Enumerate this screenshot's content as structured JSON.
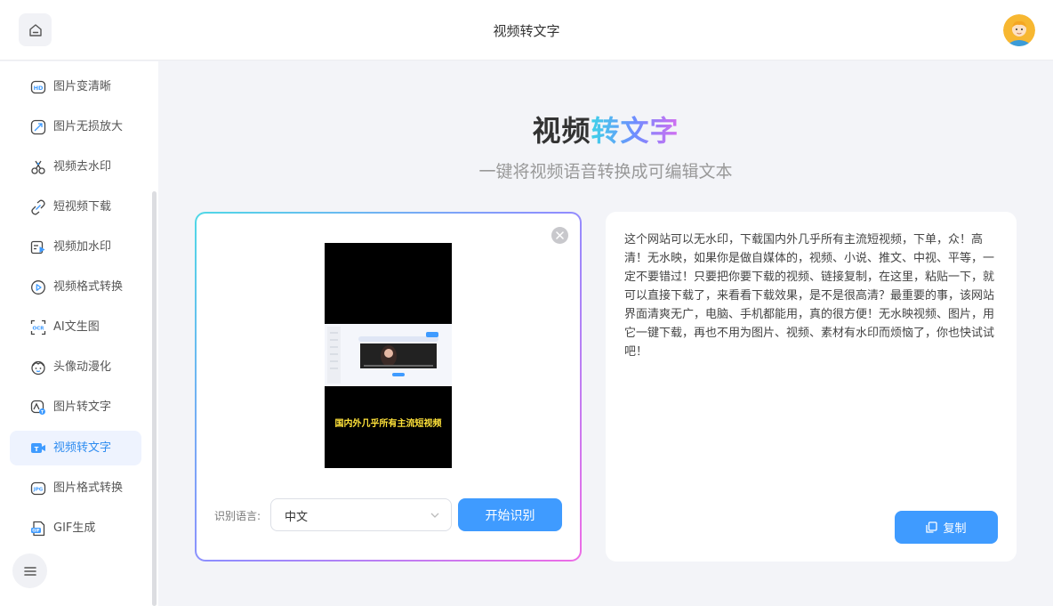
{
  "header": {
    "title": "视频转文字"
  },
  "sidebar": {
    "items": [
      {
        "label": "图片变清晰",
        "icon": "hd-icon"
      },
      {
        "label": "图片无损放大",
        "icon": "enlarge-icon"
      },
      {
        "label": "视频去水印",
        "icon": "scissors-icon"
      },
      {
        "label": "短视频下载",
        "icon": "link-icon"
      },
      {
        "label": "视频加水印",
        "icon": "video-watermark-icon"
      },
      {
        "label": "视频格式转换",
        "icon": "play-circle-icon"
      },
      {
        "label": "AI文生图",
        "icon": "scan-text-icon"
      },
      {
        "label": "头像动漫化",
        "icon": "face-icon"
      },
      {
        "label": "图片转文字",
        "icon": "image-text-icon"
      },
      {
        "label": "视频转文字",
        "icon": "video-text-icon",
        "active": true
      },
      {
        "label": "图片格式转换",
        "icon": "image-format-icon"
      },
      {
        "label": "GIF生成",
        "icon": "gif-icon"
      }
    ]
  },
  "main": {
    "title_part1": "视频",
    "title_part2": "转文字",
    "subtitle": "一键将视频语音转换成可编辑文本",
    "video_caption": "国内外几乎所有主流短视频",
    "lang_label": "识别语言:",
    "lang_value": "中文",
    "start_label": "开始识别",
    "result_text": "这个网站可以无水印，下载国内外几乎所有主流短视频，下单，众！高清！无水映，如果你是做自媒体的，视频、小说、推文、中视、平等，一定不要错过！只要把你要下载的视频、链接复制，在这里，粘贴一下，就可以直接下载了，来看看下载效果，是不是很高清？最重要的事，该网站界面清爽无广，电脑、手机都能用，真的很方便！无水映视频、图片，用它一键下载，再也不用为图片、视频、素材有水印而烦恼了，你也快试试吧！",
    "copy_label": "复制"
  },
  "colors": {
    "accent": "#3f9bff",
    "active_bg": "#eef3fe",
    "active_text": "#2e8cf0"
  }
}
